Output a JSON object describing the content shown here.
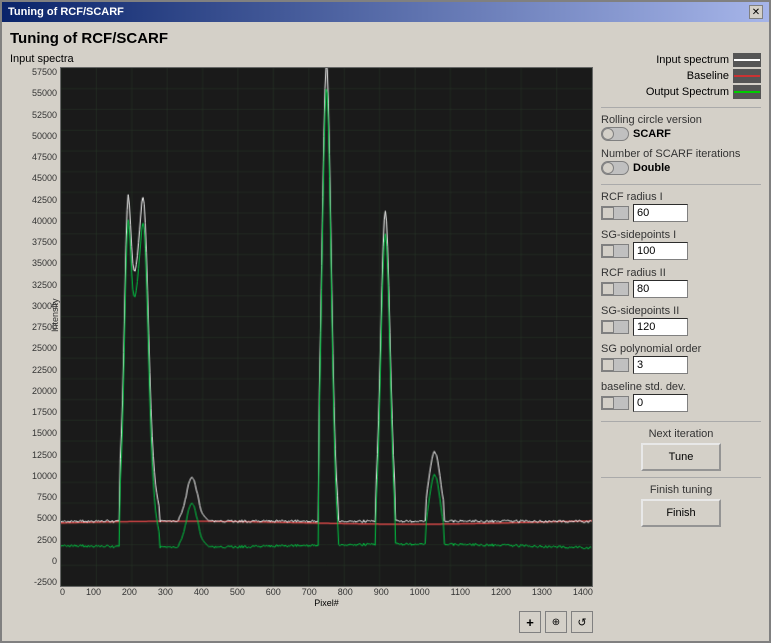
{
  "window": {
    "title": "Tuning of RCF/SCARF",
    "close_label": "✕"
  },
  "main_title": "Tuning of RCF/SCARF",
  "chart": {
    "top_label": "Input spectra",
    "x_axis_label": "Pixel#",
    "y_axis_label": "Intensity",
    "x_ticks": [
      "0",
      "100",
      "200",
      "300",
      "400",
      "500",
      "600",
      "700",
      "800",
      "900",
      "1000",
      "1100",
      "1200",
      "1300",
      "1400"
    ],
    "y_ticks": [
      "57500",
      "55000",
      "52500",
      "50000",
      "47500",
      "45000",
      "42500",
      "40000",
      "37500",
      "35000",
      "32500",
      "30000",
      "27500",
      "25000",
      "22500",
      "20000",
      "17500",
      "15000",
      "12500",
      "10000",
      "7500",
      "5000",
      "2500",
      "0",
      "-2500"
    ]
  },
  "legend": {
    "items": [
      {
        "label": "Input spectrum",
        "type": "white"
      },
      {
        "label": "Baseline",
        "type": "red"
      },
      {
        "label": "Output Spectrum",
        "type": "green"
      }
    ]
  },
  "controls": {
    "rolling_circle": {
      "label": "Rolling circle version",
      "value": "SCARF"
    },
    "scarf_iterations": {
      "label": "Number of SCARF iterations",
      "value": "Double"
    },
    "rcf_radius_i": {
      "label": "RCF radius I",
      "value": "60"
    },
    "sg_sidepoints_i": {
      "label": "SG-sidepoints I",
      "value": "100"
    },
    "rcf_radius_ii": {
      "label": "RCF radius II",
      "value": "80"
    },
    "sg_sidepoints_ii": {
      "label": "SG-sidepoints II",
      "value": "120"
    },
    "sg_polynomial_order": {
      "label": "SG polynomial order",
      "value": "3"
    },
    "baseline_std_dev": {
      "label": "baseline std. dev.",
      "value": "0"
    },
    "next_iteration_label": "Next iteration",
    "tune_label": "Tune",
    "finish_tuning_label": "Finish tuning",
    "finish_label": "Finish"
  },
  "bottom_icons": {
    "zoom_label": "+",
    "search_label": "⊕",
    "reset_label": "↺"
  }
}
